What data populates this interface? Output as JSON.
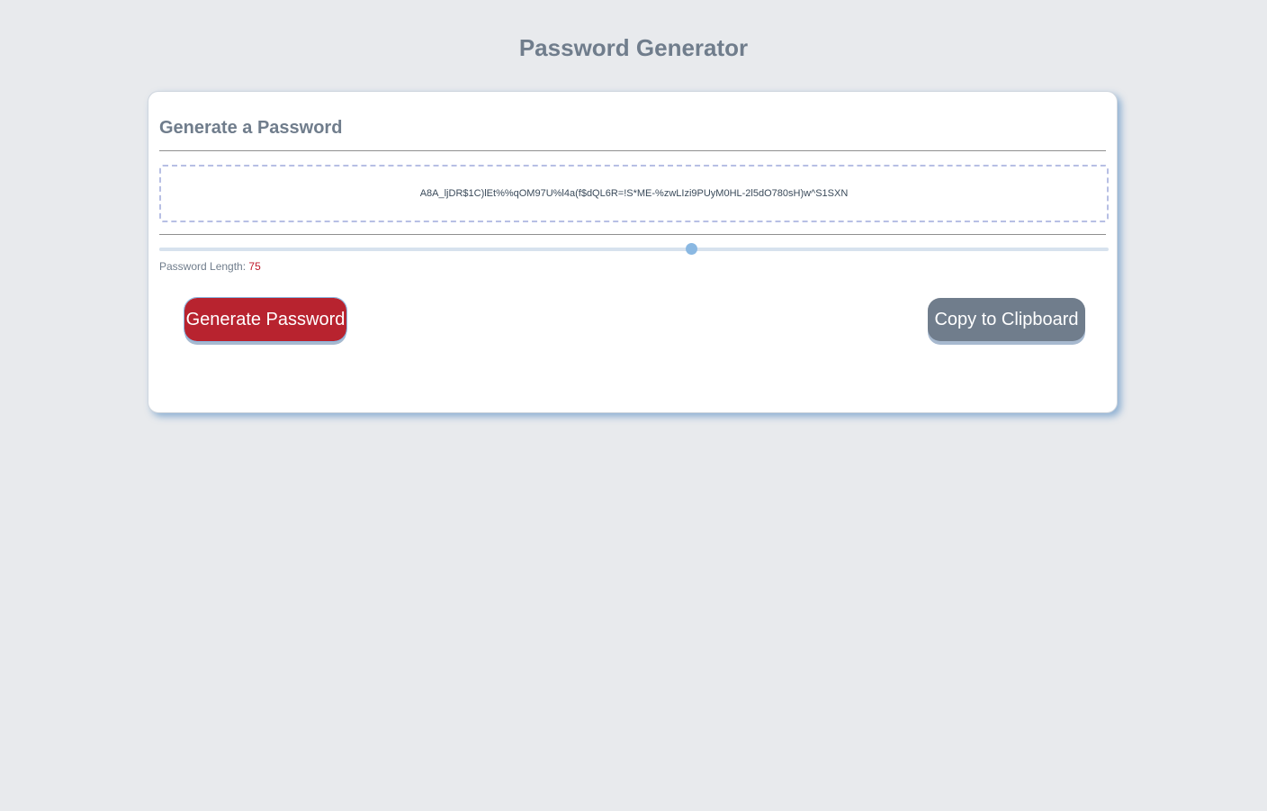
{
  "header": {
    "title": "Password Generator"
  },
  "card": {
    "title": "Generate a Password",
    "password": "A8A_ljDR$1C)lEt%%qOM97U%l4a(f$dQL6R=!S*ME-%zwLIzi9PUyM0HL-2l5dO780sH)w^S1SXN",
    "slider": {
      "value": 75,
      "fraction": 0.56
    },
    "length_label": "Password Length:",
    "length_value": "75",
    "generate_label": "Generate Password",
    "copy_label": "Copy to Clipboard"
  },
  "colors": {
    "background": "#e8eaed",
    "title": "#707d8c",
    "generate_button": "#b8232f",
    "copy_button": "#707d8c",
    "length_value": "#c01a2c",
    "slider_thumb": "#8ab8e2"
  }
}
